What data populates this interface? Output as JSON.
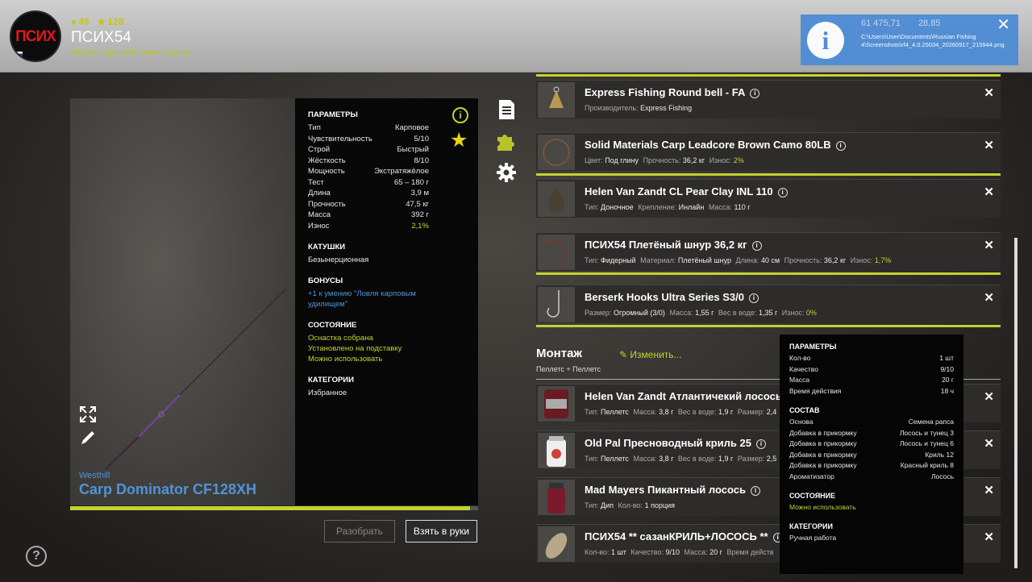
{
  "header": {
    "logo_text": "ПСИХ",
    "coins": "49",
    "stars": "128",
    "player_name": "ПСИХ54",
    "rank": "Мастер карповой ловли 7 ранга"
  },
  "notification": {
    "money1": "61 475,71",
    "money2": "28,85",
    "path": "C:\\Users\\User\\Documents\\Russian Fishing 4\\Screenshots\\rf4_4.0.25034_20260917_215944.png"
  },
  "rod": {
    "brand": "Westhill",
    "name": "Carp Dominator CF128XH",
    "durability_fraction": 0.98,
    "params_title": "ПАРАМЕТРЫ",
    "params": [
      {
        "label": "Тип",
        "value": "Карповое"
      },
      {
        "label": "Чувствительность",
        "value": "5/10"
      },
      {
        "label": "Строй",
        "value": "Быстрый"
      },
      {
        "label": "Жёсткость",
        "value": "8/10"
      },
      {
        "label": "Мощность",
        "value": "Экстратяжёлое"
      },
      {
        "label": "Тест",
        "value": "65 – 180 г"
      },
      {
        "label": "Длина",
        "value": "3,9 м"
      },
      {
        "label": "Прочность",
        "value": "47,5 кг"
      },
      {
        "label": "Масса",
        "value": "392 г"
      },
      {
        "label": "Износ",
        "value": "2,1%"
      }
    ],
    "reels_title": "КАТУШКИ",
    "reels": "Безынерционная",
    "bonus_title": "БОНУСЫ",
    "bonus": "+1 к умению \"Ловля карповым удилищем\"",
    "state_title": "СОСТОЯНИЕ",
    "states": [
      "Оснастка собрана",
      "Установлено на подставку",
      "Можно использовать"
    ],
    "cat_title": "КАТЕГОРИИ",
    "category": "Избранное"
  },
  "buttons": {
    "disassemble": "Разобрать",
    "take": "Взять в руки"
  },
  "tackle": [
    {
      "name": "Express Fishing Round bell - FA",
      "props": [
        {
          "k": "Производитель:",
          "v": "Express Fishing"
        }
      ]
    },
    {
      "name": "Solid Materials Carp Leadcore Brown Camo 80LB",
      "props": [
        {
          "k": "Цвет:",
          "v": "Под глину"
        },
        {
          "k": "Прочность:",
          "v": "36,2 кг"
        },
        {
          "k": "Износ:",
          "v": "2%"
        }
      ]
    },
    {
      "name": "Helen Van Zandt CL Pear Clay INL 110",
      "props": [
        {
          "k": "Тип:",
          "v": "Доночное"
        },
        {
          "k": "Крепление:",
          "v": "Инлайн"
        },
        {
          "k": "Масса:",
          "v": "110 г"
        }
      ]
    },
    {
      "name": "ПСИХ54 Плетёный шнур 36,2 кг",
      "props": [
        {
          "k": "Тип:",
          "v": "Фидерный"
        },
        {
          "k": "Материал:",
          "v": "Плетёный шнур"
        },
        {
          "k": "Длина:",
          "v": "40 см"
        },
        {
          "k": "Прочность:",
          "v": "36,2 кг"
        },
        {
          "k": "Износ:",
          "v": "1,7%"
        }
      ]
    },
    {
      "name": "Berserk Hooks Ultra Series S3/0",
      "props": [
        {
          "k": "Размер:",
          "v": "Огромный (3/0)"
        },
        {
          "k": "Масса:",
          "v": "1,55 г"
        },
        {
          "k": "Вес в воде:",
          "v": "1,35 г"
        },
        {
          "k": "Износ:",
          "v": "0%"
        }
      ]
    }
  ],
  "montage": {
    "title": "Монтаж",
    "subtitle": "Пеллетс + Пеллетс",
    "change": "Изменить..."
  },
  "baits": [
    {
      "name": "Helen Van Zandt Атлантичекий лосось",
      "props": [
        {
          "k": "Тип:",
          "v": "Пеллетс"
        },
        {
          "k": "Масса:",
          "v": "3,8 г"
        },
        {
          "k": "Вес в воде:",
          "v": "1,9 г"
        },
        {
          "k": "Размер:",
          "v": "2,4"
        }
      ]
    },
    {
      "name": "Old Pal Пресноводный криль 25",
      "props": [
        {
          "k": "Тип:",
          "v": "Пеллетс"
        },
        {
          "k": "Масса:",
          "v": "3,8 г"
        },
        {
          "k": "Вес в воде:",
          "v": "1,9 г"
        },
        {
          "k": "Размер:",
          "v": "2,5"
        }
      ]
    },
    {
      "name": "Mad Mayers Пикантный лосось",
      "props": [
        {
          "k": "Тип:",
          "v": "Дип"
        },
        {
          "k": "Кол-во:",
          "v": "1 порция"
        }
      ]
    },
    {
      "name": "ПСИХ54 ** сазанКРИЛЬ+ЛОСОСЬ **",
      "props": [
        {
          "k": "Кол-во:",
          "v": "1 шт"
        },
        {
          "k": "Качество:",
          "v": "9/10"
        },
        {
          "k": "Масса:",
          "v": "20 г"
        },
        {
          "k": "Время действ",
          "v": ""
        }
      ]
    }
  ],
  "tooltip": {
    "params_title": "ПАРАМЕТРЫ",
    "params": [
      {
        "label": "Кол-во",
        "value": "1 шт"
      },
      {
        "label": "Качество",
        "value": "9/10"
      },
      {
        "label": "Масса",
        "value": "20 г"
      },
      {
        "label": "Время действия",
        "value": "18 ч"
      }
    ],
    "comp_title": "СОСТАВ",
    "composition": [
      {
        "label": "Основа",
        "value": "Семена рапса"
      },
      {
        "label": "Добавка в прикормку",
        "value": "Лосось и тунец 3"
      },
      {
        "label": "Добавка в прикормку",
        "value": "Лосось и тунец 6"
      },
      {
        "label": "Добавка в прикормку",
        "value": "Криль 12"
      },
      {
        "label": "Добавка в прикормку",
        "value": "Красный криль 8"
      },
      {
        "label": "Ароматизатор",
        "value": "Лосось"
      }
    ],
    "state_title": "СОСТОЯНИЕ",
    "state": "Можно использовать",
    "cat_title": "КАТЕГОРИИ",
    "category": "Ручная работа"
  }
}
